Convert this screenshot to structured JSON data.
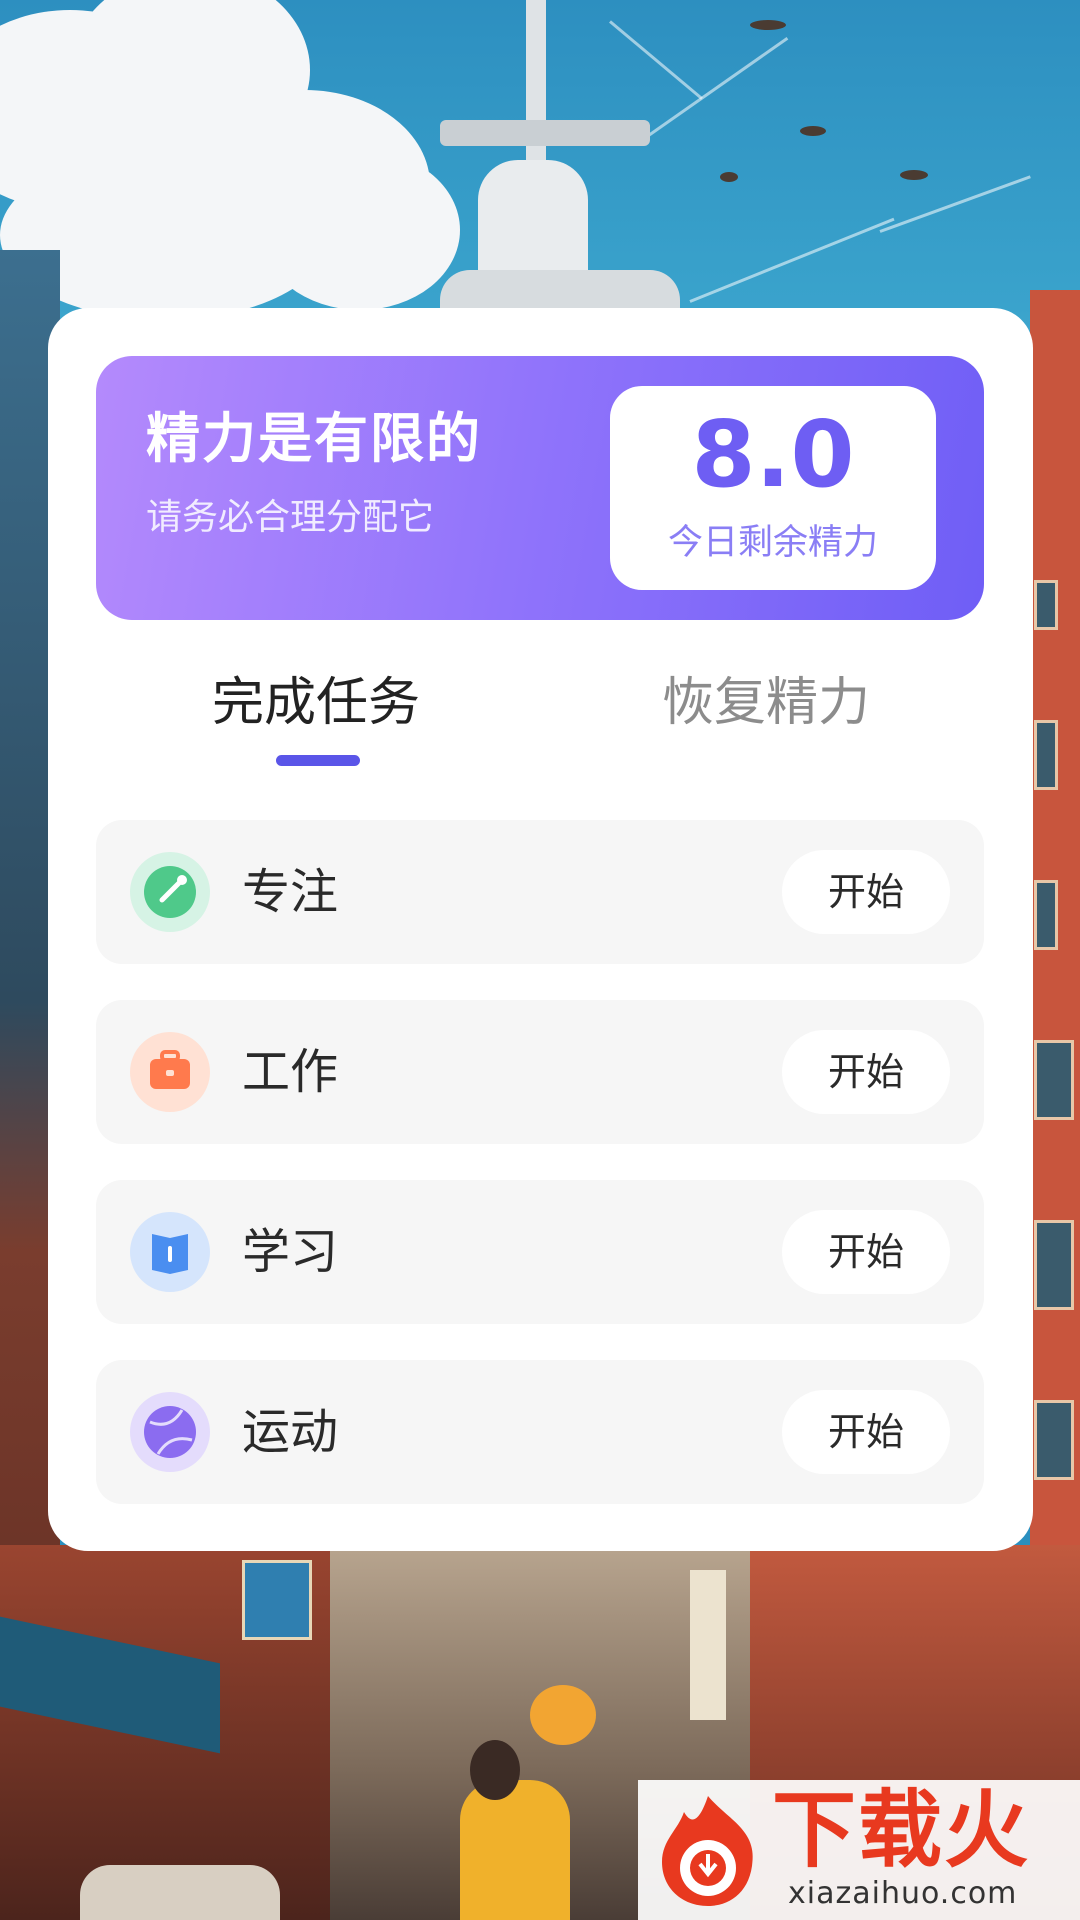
{
  "banner": {
    "title": "精力是有限的",
    "subtitle": "请务必合理分配它",
    "energy_value": "8.0",
    "energy_label": "今日剩余精力"
  },
  "tabs": [
    {
      "label": "完成任务",
      "active": true
    },
    {
      "label": "恢复精力",
      "active": false
    }
  ],
  "tasks": [
    {
      "name": "专注",
      "button": "开始",
      "icon": "focus-icon",
      "color": "#4fc98a"
    },
    {
      "name": "工作",
      "button": "开始",
      "icon": "briefcase-icon",
      "color": "#ff8a5c"
    },
    {
      "name": "学习",
      "button": "开始",
      "icon": "book-icon",
      "color": "#4a8ef0"
    },
    {
      "name": "运动",
      "button": "开始",
      "icon": "ball-icon",
      "color": "#8b6cf0"
    }
  ],
  "watermark": {
    "title": "下载火",
    "url": "xiazaihuo.com"
  },
  "colors": {
    "accent": "#5a55e8",
    "banner_start": "#b48afc",
    "banner_end": "#6f5ef6",
    "energy_value": "#6e5ef3"
  }
}
